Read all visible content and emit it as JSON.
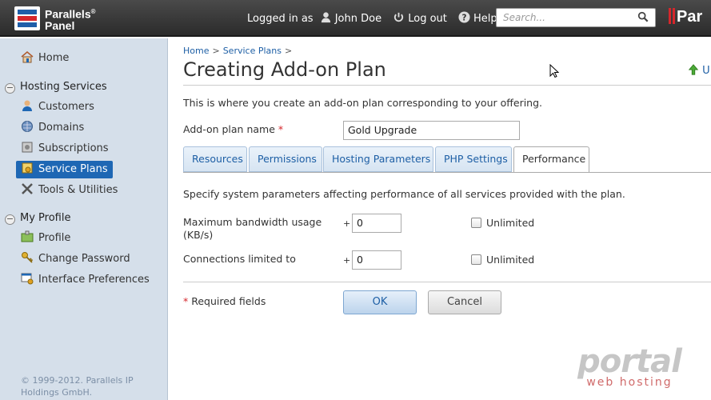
{
  "header": {
    "brand_line1": "Parallels",
    "brand_line2": "Panel",
    "logged_in_as": "Logged in as",
    "user_name": "John Doe",
    "logout": "Log out",
    "help": "Help",
    "search_placeholder": "Search...",
    "parallels_logo": "Par"
  },
  "sidebar": {
    "home": "Home",
    "hosting_services": "Hosting Services",
    "customers": "Customers",
    "domains": "Domains",
    "subscriptions": "Subscriptions",
    "service_plans": "Service Plans",
    "tools_utilities": "Tools & Utilities",
    "my_profile": "My Profile",
    "profile": "Profile",
    "change_password": "Change Password",
    "interface_preferences": "Interface Preferences",
    "copyright": "© 1999-2012. Parallels IP Holdings GmbH."
  },
  "breadcrumb": {
    "home": "Home",
    "service_plans": "Service Plans",
    "sep": ">"
  },
  "page": {
    "title": "Creating Add-on Plan",
    "up_link": "U",
    "description": "This is where you create an add-on plan corresponding to your offering.",
    "plan_name_label": "Add-on plan name",
    "plan_name_value": "Gold Upgrade",
    "required_mark": "*"
  },
  "tabs": [
    "Resources",
    "Permissions",
    "Hosting Parameters",
    "PHP Settings",
    "Performance"
  ],
  "performance": {
    "intro": "Specify system parameters affecting performance of all services provided with the plan.",
    "bandwidth_label": "Maximum bandwidth usage (KB/s)",
    "bandwidth_value": "0",
    "connections_label": "Connections limited to",
    "connections_value": "0",
    "plus": "+",
    "unlimited": "Unlimited"
  },
  "footer": {
    "required_fields": "Required fields",
    "ok": "OK",
    "cancel": "Cancel"
  },
  "watermark": {
    "line1": "portal",
    "line2": "web hosting"
  },
  "colors": {
    "accent": "#1e67b4",
    "sidebar_bg": "#d5dfea",
    "required": "#d5262b"
  }
}
